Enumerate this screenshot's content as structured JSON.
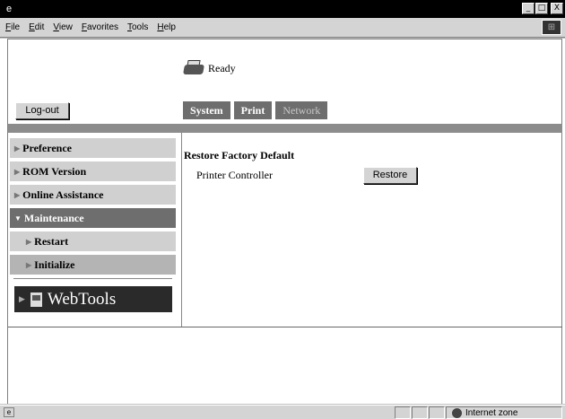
{
  "window": {
    "title": "",
    "controls": [
      "_",
      "□",
      "X"
    ]
  },
  "menu": [
    "File",
    "Edit",
    "View",
    "Favorites",
    "Tools",
    "Help"
  ],
  "header": {
    "status_text": "Ready",
    "status_icon": "printer-icon",
    "logout_label": "Log-out"
  },
  "tabs": [
    {
      "label": "System",
      "selected": false
    },
    {
      "label": "Print",
      "selected": false
    },
    {
      "label": "Network",
      "selected": true
    }
  ],
  "nav": {
    "items": [
      {
        "label": "Preference",
        "expanded": false
      },
      {
        "label": "ROM Version",
        "expanded": false
      },
      {
        "label": "Online Assistance",
        "expanded": false
      },
      {
        "label": "Maintenance",
        "expanded": true
      },
      {
        "label": "Restart",
        "sub": true
      },
      {
        "label": "Initialize",
        "sub": true
      }
    ],
    "webtools_label": "WebTools"
  },
  "main": {
    "section_title": "Restore Factory Default",
    "rows": [
      {
        "label": "Printer Controller",
        "button": "Restore"
      }
    ]
  },
  "statusbar": {
    "zone_text": "Internet zone"
  },
  "colors": {
    "tab_bg": "#6e6e6e",
    "active_nav_bg": "#6e6e6e",
    "nav_bg": "#d0d0d0",
    "banner": "#8c8c8c",
    "webtools_bg": "#2a2a2a"
  }
}
